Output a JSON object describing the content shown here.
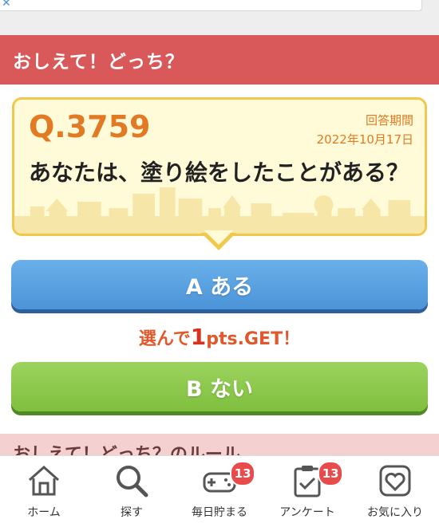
{
  "header": {
    "title": "おしえて！どっち？"
  },
  "question": {
    "number": "Q.3759",
    "period_label": "回答期間",
    "period_date": "2022年10月17日",
    "text": "あなたは、塗り絵をしたことがある？"
  },
  "answers": {
    "a_label": "A ある",
    "b_label": "B ない"
  },
  "points": {
    "prefix": "選んで",
    "amount": "1",
    "suffix": "pts.GET！"
  },
  "rules": {
    "title": "おしえて！どっち？のルール"
  },
  "tabbar": {
    "items": [
      {
        "label": "ホーム",
        "icon": "home-icon"
      },
      {
        "label": "探す",
        "icon": "search-icon"
      },
      {
        "label": "毎日貯まる",
        "icon": "gamepad-icon",
        "badge": "13"
      },
      {
        "label": "アンケート",
        "icon": "clipboard-icon",
        "badge": "13"
      },
      {
        "label": "お気に入り",
        "icon": "heart-icon"
      }
    ]
  },
  "colors": {
    "header_bg": "#d9595a",
    "accent_orange": "#e27a23",
    "button_a": "#5aa3e2",
    "button_b": "#8cc84b",
    "badge": "#e84b4b"
  }
}
